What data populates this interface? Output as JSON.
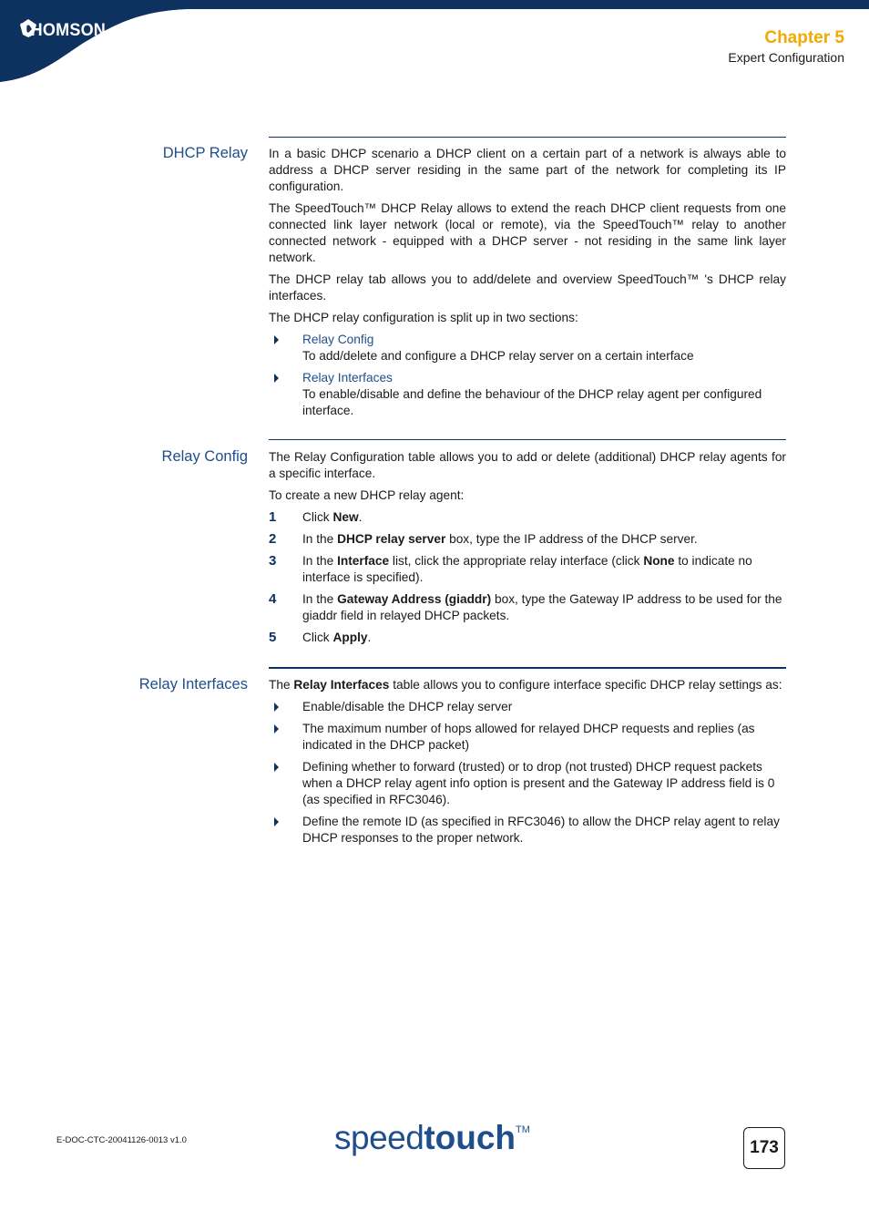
{
  "header": {
    "brand": "THOMSON",
    "chapter_title": "Chapter 5",
    "chapter_subtitle": "Expert Configuration",
    "colors": {
      "band": "#0e3260",
      "accent": "#f2a900",
      "heading": "#1f4e8c"
    }
  },
  "sections": {
    "dhcp_relay": {
      "title": "DHCP Relay",
      "paragraphs": [
        "In a basic DHCP scenario a DHCP client on a certain part of a network is always able to address a DHCP server residing in the same part of the network for completing its IP configuration.",
        "The SpeedTouch™ DHCP Relay allows to extend the reach DHCP client requests from one connected link layer network (local or remote), via the SpeedTouch™ relay to another connected network - equipped with a DHCP server - not residing in the same link layer network.",
        "The DHCP relay tab allows you to add/delete and overview SpeedTouch™ 's DHCP relay interfaces.",
        "The DHCP relay configuration is split up in two sections:"
      ],
      "bullets": [
        {
          "link": "Relay Config",
          "text": "To add/delete and configure a DHCP relay server on a certain interface"
        },
        {
          "link": "Relay Interfaces",
          "text": "To enable/disable and define the behaviour of the DHCP relay agent per configured interface."
        }
      ]
    },
    "relay_config": {
      "title": "Relay Config",
      "paragraphs": [
        "The Relay Configuration table allows you to add or delete (additional) DHCP relay agents for a specific interface.",
        "To create a new DHCP relay agent:"
      ],
      "steps": [
        {
          "num": "1",
          "pre": "Click ",
          "bold": "New",
          "post": "."
        },
        {
          "num": "2",
          "pre": "In the ",
          "bold": "DHCP relay server",
          "post": " box, type the IP address of the DHCP server."
        },
        {
          "num": "3",
          "pre": "In the ",
          "bold": "Interface",
          "mid": " list, click the appropriate relay interface (click ",
          "bold2": "None",
          "post": " to indicate no interface is specified)."
        },
        {
          "num": "4",
          "pre": "In the ",
          "bold": "Gateway Address (giaddr)",
          "post": " box, type the Gateway IP address to be used for the giaddr field in relayed DHCP packets."
        },
        {
          "num": "5",
          "pre": "Click ",
          "bold": "Apply",
          "post": "."
        }
      ]
    },
    "relay_interfaces": {
      "title": "Relay Interfaces",
      "intro_pre": "The ",
      "intro_bold": "Relay Interfaces",
      "intro_post": " table allows you to configure interface specific DHCP relay settings as:",
      "bullets": [
        "Enable/disable the DHCP relay server",
        "The maximum number of hops allowed for relayed DHCP requests and replies (as indicated in the DHCP packet)",
        "Defining whether to forward (trusted) or to drop (not trusted) DHCP request packets when a DHCP relay agent info option is present and the Gateway IP address field is 0 (as specified in RFC3046).",
        "Define the remote ID (as specified in RFC3046) to allow the DHCP relay agent to relay DHCP responses to the proper network."
      ]
    }
  },
  "footer": {
    "doc_id": "E-DOC-CTC-20041126-0013 v1.0",
    "logo_speed": "speed",
    "logo_touch": "touch",
    "logo_tm": "TM",
    "page_number": "173"
  }
}
